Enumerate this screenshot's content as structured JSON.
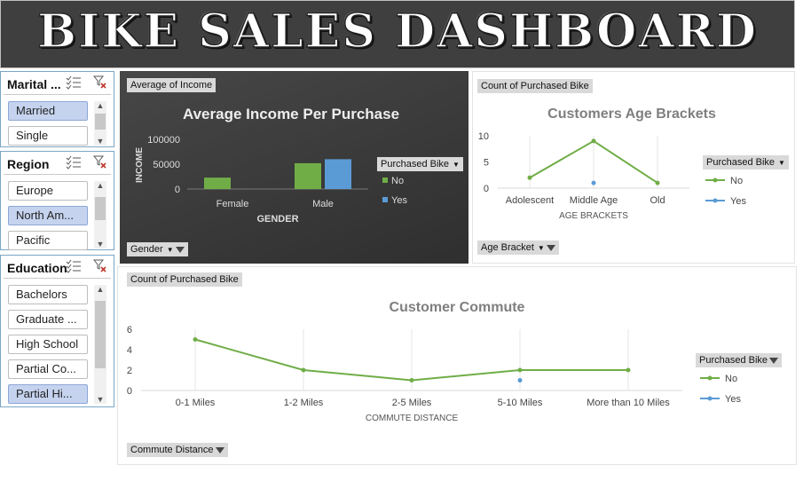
{
  "dashboard": {
    "title": "BIKE SALES DASHBOARD"
  },
  "slicers": {
    "marital": {
      "header": "Marital ...",
      "items": [
        {
          "label": "Married",
          "selected": true
        },
        {
          "label": "Single",
          "selected": false
        }
      ]
    },
    "region": {
      "header": "Region",
      "items": [
        {
          "label": "Europe",
          "selected": false
        },
        {
          "label": "North Am...",
          "selected": true
        },
        {
          "label": "Pacific",
          "selected": false
        }
      ]
    },
    "education": {
      "header": "Education",
      "items": [
        {
          "label": "Bachelors",
          "selected": false
        },
        {
          "label": "Graduate ...",
          "selected": false
        },
        {
          "label": "High School",
          "selected": false
        },
        {
          "label": "Partial Co...",
          "selected": false
        },
        {
          "label": "Partial Hi...",
          "selected": true
        }
      ]
    }
  },
  "charts": {
    "income": {
      "field_button": "Average of Income",
      "axis_button": "Gender",
      "legend_button": "Purchased Bike"
    },
    "age": {
      "field_button": "Count of Purchased Bike",
      "axis_button": "Age Bracket",
      "legend_button": "Purchased Bike"
    },
    "commute": {
      "field_button": "Count of Purchased Bike",
      "axis_button": "Commute Distance",
      "legend_button": "Purchased Bike"
    }
  },
  "chart_data": [
    {
      "id": "income",
      "type": "bar",
      "title": "Average Income Per Purchase",
      "xlabel": "GENDER",
      "ylabel": "INCOME",
      "categories": [
        "Female",
        "Male"
      ],
      "series": [
        {
          "name": "No",
          "color": "#70ad47",
          "values": [
            23000,
            52000
          ]
        },
        {
          "name": "Yes",
          "color": "#5b9bd5",
          "values": [
            null,
            60000
          ]
        }
      ],
      "ylim": [
        0,
        100000
      ],
      "yticks": [
        "0",
        "50000",
        "100000"
      ],
      "legend": "right"
    },
    {
      "id": "age",
      "type": "line",
      "title": "Customers Age Brackets",
      "xlabel": "AGE BRACKETS",
      "ylabel": "",
      "categories": [
        "Adolescent",
        "Middle Age",
        "Old"
      ],
      "series": [
        {
          "name": "No",
          "color": "#70ad47",
          "values": [
            2,
            9,
            1
          ]
        },
        {
          "name": "Yes",
          "color": "#5b9bd5",
          "values": [
            null,
            1,
            null
          ]
        }
      ],
      "ylim": [
        0,
        10
      ],
      "yticks": [
        "0",
        "5",
        "10"
      ],
      "legend": "right"
    },
    {
      "id": "commute",
      "type": "line",
      "title": "Customer Commute",
      "xlabel": "COMMUTE DISTANCE",
      "ylabel": "",
      "categories": [
        "0-1 Miles",
        "1-2 Miles",
        "2-5 Miles",
        "5-10 Miles",
        "More than 10 Miles"
      ],
      "series": [
        {
          "name": "No",
          "color": "#70ad47",
          "values": [
            5,
            2,
            1,
            2,
            2
          ]
        },
        {
          "name": "Yes",
          "color": "#5b9bd5",
          "values": [
            null,
            null,
            null,
            1,
            null
          ]
        }
      ],
      "ylim": [
        0,
        6
      ],
      "yticks": [
        "0",
        "2",
        "4",
        "6"
      ],
      "legend": "right"
    }
  ]
}
